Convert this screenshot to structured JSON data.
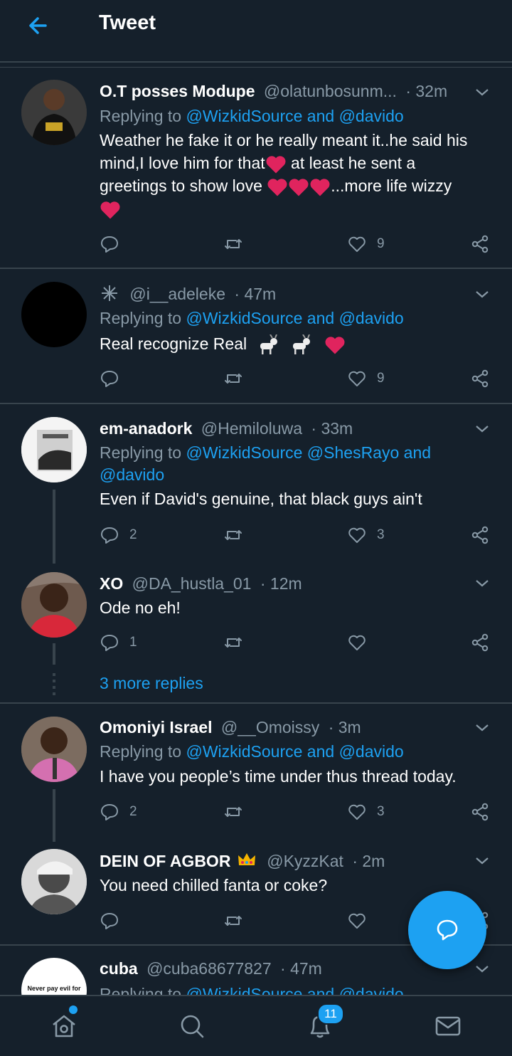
{
  "header": {
    "title": "Tweet"
  },
  "tweets": [
    {
      "name": "O.T posses Modupe",
      "handle": "@olatunbosunm...",
      "time": "· 32m",
      "replying_prefix": "Replying to",
      "replying_to": "@WizkidSource and @davido",
      "text_lines": [
        "Weather he fake it or he really meant it..he said his",
        "mind,I love him for that",
        " at least he sent a",
        "greetings to show love ",
        "...more life wizzy"
      ],
      "likes": "9"
    },
    {
      "name": "",
      "handle": "@i__adeleke",
      "time": "· 47m",
      "replying_prefix": "Replying to",
      "replying_to": "@WizkidSource and @davido",
      "text": "Real recognize Real",
      "likes": "9"
    },
    {
      "name": "em-anadork",
      "handle": "@Hemiloluwa",
      "time": "· 33m",
      "replying_prefix": "Replying to",
      "replying_to_line1": "@WizkidSource @ShesRayo and",
      "replying_to_line2": "@davido",
      "text": "Even if David's genuine, that black guys ain't",
      "replies": "2",
      "likes": "3"
    },
    {
      "name": "XO",
      "handle": "@DA_hustla_01",
      "time": "· 12m",
      "text": "Ode no eh!",
      "replies": "1",
      "more_replies": "3 more replies"
    },
    {
      "name": "Omoniyi Israel",
      "handle": "@__Omoissy",
      "time": "· 3m",
      "replying_prefix": "Replying to",
      "replying_to": "@WizkidSource and @davido",
      "text": "I have you people’s time under thus thread today.",
      "replies": "2",
      "likes": "3"
    },
    {
      "name": "DEIN OF AGBOR",
      "handle": "@KyzzKat",
      "time": "· 2m",
      "text": "You need chilled fanta or coke?"
    },
    {
      "name": "cuba",
      "handle": "@cuba68677827",
      "time": "· 47m",
      "replying_prefix": "Replying to",
      "replying_to": "@WizkidSource and @davido",
      "avatar_text": "Never pay evil for"
    }
  ],
  "nav": {
    "notifications_badge": "11"
  },
  "colors": {
    "background": "#15202b",
    "accent": "#1da1f2",
    "muted": "#8899a6",
    "divider": "#38444d",
    "heart": "#e0245e"
  }
}
